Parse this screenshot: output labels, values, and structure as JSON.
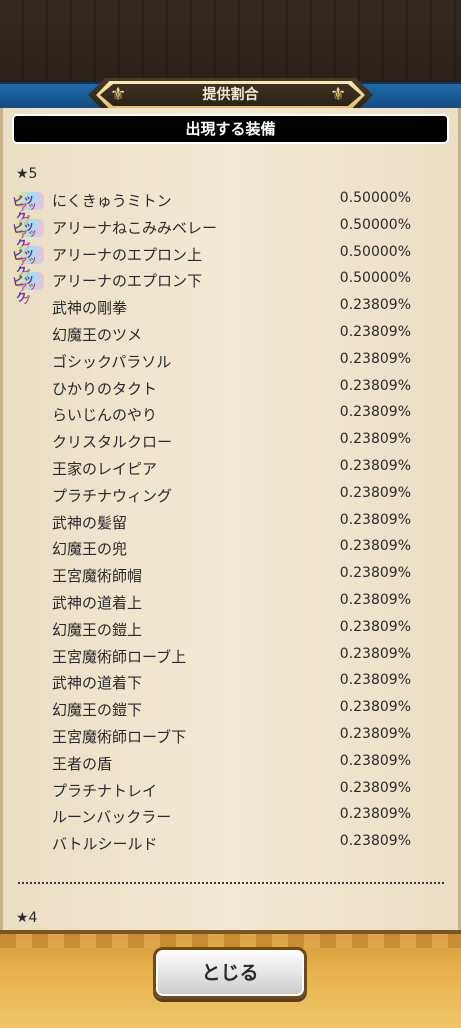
{
  "window": {
    "title": "提供割合"
  },
  "header": {
    "label": "出現する装備"
  },
  "sections": [
    {
      "label": "★5"
    },
    {
      "label": "★4"
    }
  ],
  "badge": {
    "line1": "ピック",
    "line2": "アップ"
  },
  "items": [
    {
      "name": "にくきゅうミトン",
      "rate": "0.50000%",
      "pickup": true
    },
    {
      "name": "アリーナねこみみベレー",
      "rate": "0.50000%",
      "pickup": true
    },
    {
      "name": "アリーナのエプロン上",
      "rate": "0.50000%",
      "pickup": true
    },
    {
      "name": "アリーナのエプロン下",
      "rate": "0.50000%",
      "pickup": true
    },
    {
      "name": "武神の剛拳",
      "rate": "0.23809%",
      "pickup": false
    },
    {
      "name": "幻魔王のツメ",
      "rate": "0.23809%",
      "pickup": false
    },
    {
      "name": "ゴシックパラソル",
      "rate": "0.23809%",
      "pickup": false
    },
    {
      "name": "ひかりのタクト",
      "rate": "0.23809%",
      "pickup": false
    },
    {
      "name": "らいじんのやり",
      "rate": "0.23809%",
      "pickup": false
    },
    {
      "name": "クリスタルクロー",
      "rate": "0.23809%",
      "pickup": false
    },
    {
      "name": "王家のレイピア",
      "rate": "0.23809%",
      "pickup": false
    },
    {
      "name": "プラチナウィング",
      "rate": "0.23809%",
      "pickup": false
    },
    {
      "name": "武神の髪留",
      "rate": "0.23809%",
      "pickup": false
    },
    {
      "name": "幻魔王の兜",
      "rate": "0.23809%",
      "pickup": false
    },
    {
      "name": "王宮魔術師帽",
      "rate": "0.23809%",
      "pickup": false
    },
    {
      "name": "武神の道着上",
      "rate": "0.23809%",
      "pickup": false
    },
    {
      "name": "幻魔王の鎧上",
      "rate": "0.23809%",
      "pickup": false
    },
    {
      "name": "王宮魔術師ローブ上",
      "rate": "0.23809%",
      "pickup": false
    },
    {
      "name": "武神の道着下",
      "rate": "0.23809%",
      "pickup": false
    },
    {
      "name": "幻魔王の鎧下",
      "rate": "0.23809%",
      "pickup": false
    },
    {
      "name": "王宮魔術師ローブ下",
      "rate": "0.23809%",
      "pickup": false
    },
    {
      "name": "王者の盾",
      "rate": "0.23809%",
      "pickup": false
    },
    {
      "name": "プラチナトレイ",
      "rate": "0.23809%",
      "pickup": false
    },
    {
      "name": "ルーンバックラー",
      "rate": "0.23809%",
      "pickup": false
    },
    {
      "name": "バトルシールド",
      "rate": "0.23809%",
      "pickup": false
    }
  ],
  "footer": {
    "close_label": "とじる"
  },
  "colors": {
    "title_bar": "#1f6aa8",
    "paper": "#f3ead5",
    "footer": "#e7b24e"
  }
}
